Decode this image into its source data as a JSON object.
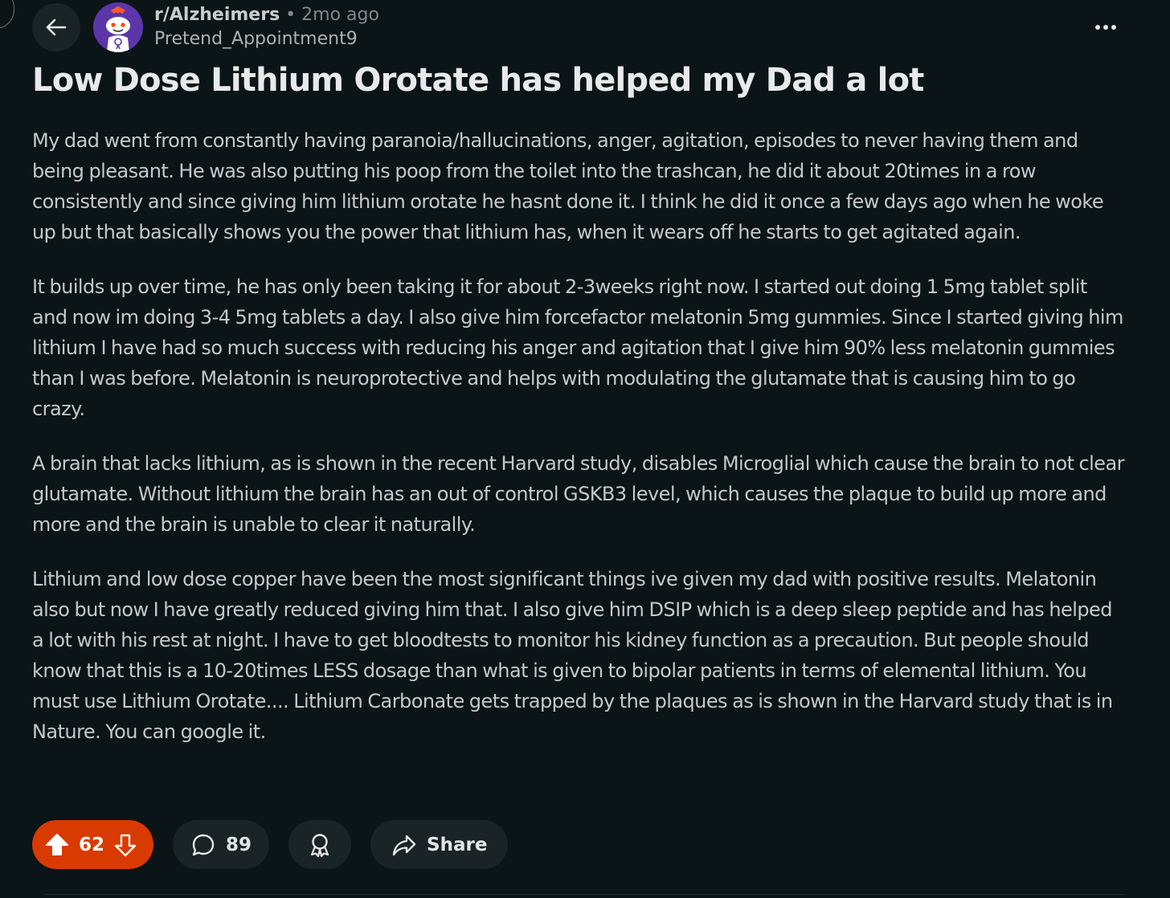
{
  "header": {
    "subreddit": "r/Alzheimers",
    "separator": "•",
    "age": "2mo ago",
    "author": "Pretend_Appointment9"
  },
  "post": {
    "title": "Low Dose Lithium Orotate has helped my Dad a lot",
    "paragraphs": [
      "My dad went from constantly having paranoia/hallucinations, anger, agitation, episodes to never having them and being pleasant. He was also putting his poop from the toilet into the trashcan, he did it about 20times in a row consistently and since giving him lithium orotate he hasnt done it. I think he did it once a few days ago when he woke up but that basically shows you the power that lithium has, when it wears off he starts to get agitated again.",
      "It builds up over time, he has only been taking it for about 2-3weeks right now. I started out doing 1 5mg tablet split and now im doing 3-4 5mg tablets a day. I also give him forcefactor melatonin 5mg gummies. Since I started giving him lithium I have had so much success with reducing his anger and agitation that I give him 90% less melatonin gummies than I was before. Melatonin is neuroprotective and helps with modulating the glutamate that is causing him to go crazy.",
      "A brain that lacks lithium, as is shown in the recent Harvard study, disables Microglial which cause the brain to not clear glutamate. Without lithium the brain has an out of control GSKB3 level, which causes the plaque to build up more and more and the brain is unable to clear it naturally.",
      "Lithium and low dose copper have been the most significant things ive given my dad with positive results. Melatonin also but now I have greatly reduced giving him that. I also give him DSIP which is a deep sleep peptide and has helped a lot with his rest at night. I have to get bloodtests to monitor his kidney function as a precaution. But people should know that this is a 10-20times LESS dosage than what is given to bipolar patients in terms of elemental lithium. You must use Lithium Orotate.... Lithium Carbonate gets trapped by the plaques as is shown in the Harvard study that is in Nature. You can google it."
    ]
  },
  "actions": {
    "votes": "62",
    "comments": "89",
    "share_label": "Share"
  },
  "colors": {
    "background": "#0b1416",
    "upvoted_accent": "#d93a00",
    "pill_background": "#1a2326"
  },
  "icons": {
    "back": "arrow-left-icon",
    "subreddit_avatar": "snoo-avatar-icon",
    "more": "more-horizontal-icon",
    "upvote": "upvote-arrow-icon",
    "downvote": "downvote-arrow-icon",
    "comment": "comment-bubble-icon",
    "award": "award-icon",
    "share": "share-arrow-icon"
  }
}
